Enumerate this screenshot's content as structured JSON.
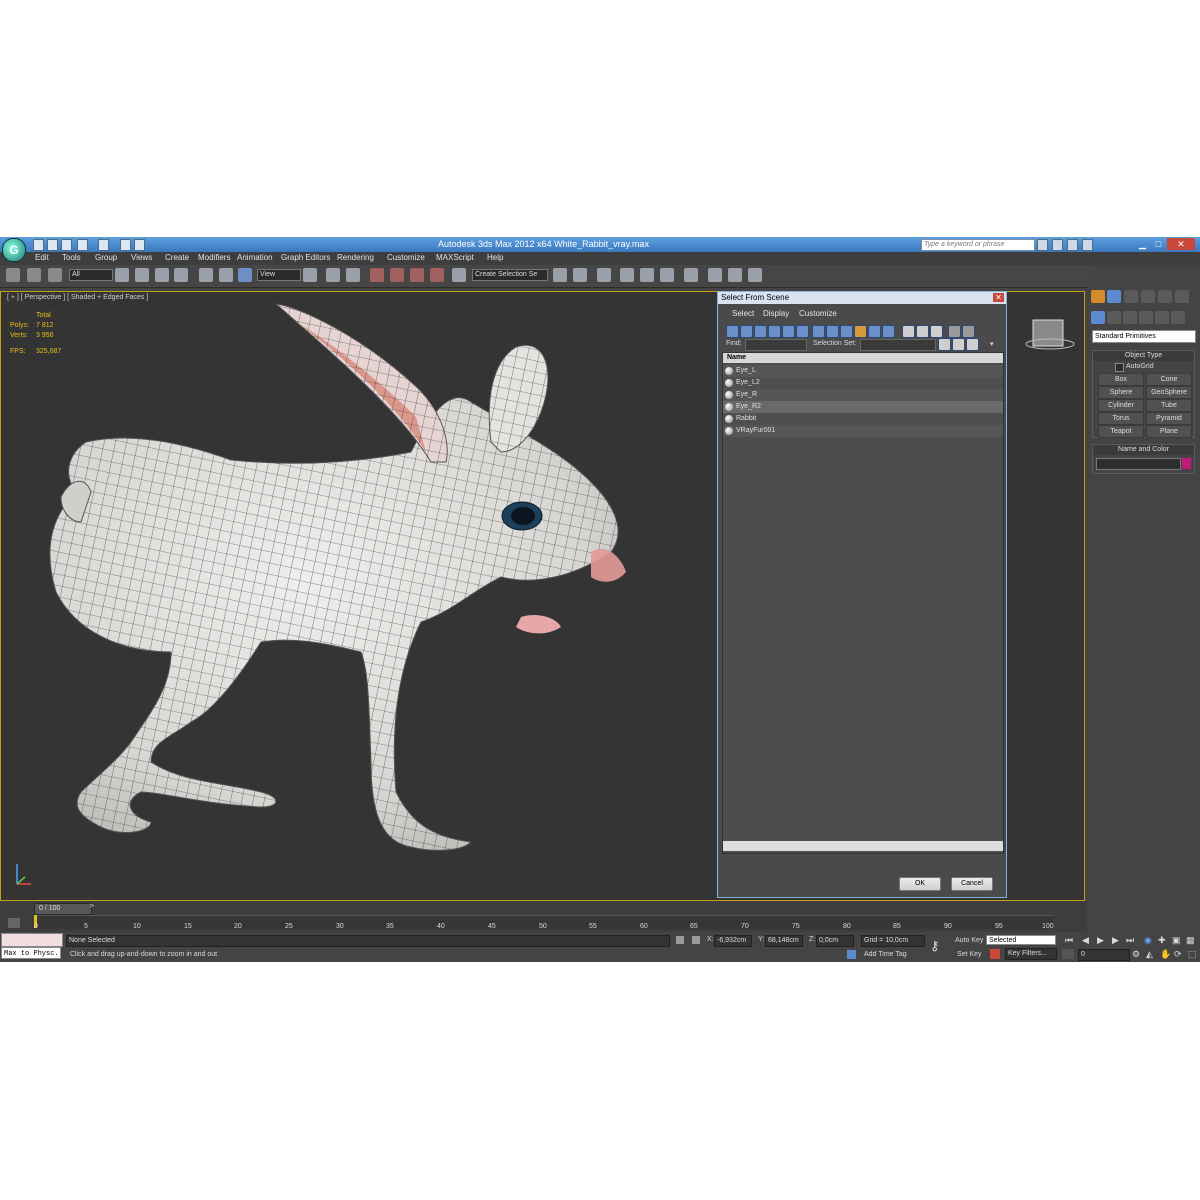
{
  "app": {
    "title": "Autodesk 3ds Max  2012 x64     White_Rabbit_vray.max",
    "search_placeholder": "Type a keyword or phrase",
    "accent": "#3a78c0",
    "highlight": "#c6a012"
  },
  "menu": [
    "Edit",
    "Tools",
    "Group",
    "Views",
    "Create",
    "Modifiers",
    "Animation",
    "Graph Editors",
    "Rendering",
    "Customize",
    "MAXScript",
    "Help"
  ],
  "toolbar": {
    "selection_filter": "All",
    "reference_coord": "View",
    "selection_set": "Create Selection Se"
  },
  "viewport": {
    "label": "[ + ] [ Perspective ] [ Shaded + Edged Faces ]",
    "stats": {
      "total_label": "Total",
      "polys_label": "Polys:",
      "polys_value": "7 812",
      "verts_label": "Verts:",
      "verts_value": "3 956",
      "fps_label": "FPS:",
      "fps_value": "325,687"
    }
  },
  "dialog": {
    "title": "Select From Scene",
    "menu": [
      "Select",
      "Display",
      "Customize"
    ],
    "find_label": "Find:",
    "selection_set_label": "Selection Set:",
    "column_name": "Name",
    "items": [
      "Eye_L",
      "Eye_L2",
      "Eye_R",
      "Eye_R2",
      "Rabbit",
      "VRayFur001"
    ],
    "ok": "OK",
    "cancel": "Cancel"
  },
  "command_panel": {
    "category": "Standard Primitives",
    "object_type_header": "Object Type",
    "autogrid": "AutoGrid",
    "primitives": [
      "Box",
      "Cone",
      "Sphere",
      "GeoSphere",
      "Cylinder",
      "Tube",
      "Torus",
      "Pyramid",
      "Teapot",
      "Plane"
    ],
    "name_color_header": "Name and Color",
    "object_color": "#c2187a"
  },
  "timeline": {
    "frame_counter": "0 / 100",
    "ticks": [
      "0",
      "5",
      "10",
      "15",
      "20",
      "25",
      "30",
      "35",
      "40",
      "45",
      "50",
      "55",
      "60",
      "65",
      "70",
      "75",
      "80",
      "85",
      "90",
      "95",
      "100"
    ]
  },
  "status": {
    "script_listener": "Max to Physc.",
    "selection": "None Selected",
    "prompt": "Click and drag up-and-down to zoom in and out",
    "x_label": "X:",
    "x_value": "-6,932cm",
    "y_label": "Y:",
    "y_value": "68,148cm",
    "z_label": "Z:",
    "z_value": "0,0cm",
    "grid": "Grid = 10,0cm",
    "add_time_tag": "Add Time Tag",
    "auto_key": "Auto Key",
    "set_key": "Set Key",
    "key_mode": "Selected",
    "key_filters": "Key Filters...",
    "frame": "0"
  }
}
